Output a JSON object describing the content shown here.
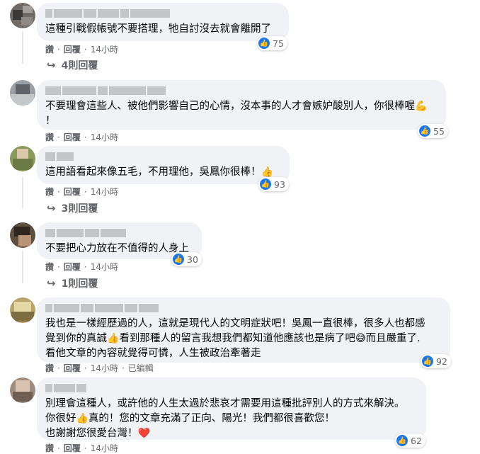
{
  "comments": [
    {
      "text": "這種引戰假帳號不要搭理，牠自討沒去就會離開了",
      "likes": "75",
      "read": "讚",
      "reply": "回覆",
      "time": "14小時",
      "replies": "4則回覆"
    },
    {
      "text": "不要理會這些人、被他們影響自己的心情，沒本事的人才會嫉妒酸別人，你很棒喔",
      "emoji": "💪",
      "text_end": "！",
      "likes": "55",
      "read": "讚",
      "reply": "回覆",
      "time": "14小時"
    },
    {
      "text": "這用語看起來像五毛，不用理他，吳鳳你很棒！",
      "emoji": "👍",
      "likes": "93",
      "read": "讚",
      "reply": "回覆",
      "time": "14小時",
      "replies": "3則回覆"
    },
    {
      "text": "不要把心力放在不值得的人身上",
      "likes": "30",
      "read": "讚",
      "reply": "回覆",
      "time": "14小時",
      "replies": "1則回覆"
    },
    {
      "line1": "我也是一樣經歷過的人，這就是現代人的文明症狀吧！吳鳳一直很棒，很多人也都感",
      "line2a": "覺到你的真誠",
      "emoji1": "👍",
      "line2b": "看到那種人的留言我想我們都知道他應該也是病了吧",
      "emoji2": "😅",
      "line2c": "而且嚴重了.",
      "line3": "看他文章的內容就覺得可憐，人生被政治牽著走",
      "likes": "92",
      "read": "讚",
      "reply": "回覆",
      "time": "14小時",
      "edited": "已編輯"
    },
    {
      "line1": "別理會這種人，或許他的人生太過於悲哀才需要用這種批評別人的方式來解決。",
      "line2a": "你很好",
      "emoji1": "👍",
      "line2b": "真的！您的文章充滿了正向、陽光！我們都很喜歡您！",
      "line3": "也謝謝您很愛台灣！",
      "emoji2": "❤️",
      "likes": "62",
      "read": "讚",
      "reply": "回覆",
      "time": "14小時"
    }
  ],
  "icons": {
    "like": "thumbs-up-icon",
    "reply_arrow": "reply-arrow-icon"
  },
  "colors": {
    "bubble": "#f0f2f5",
    "like_blue": "#1877f2",
    "meta_gray": "#65676b"
  }
}
